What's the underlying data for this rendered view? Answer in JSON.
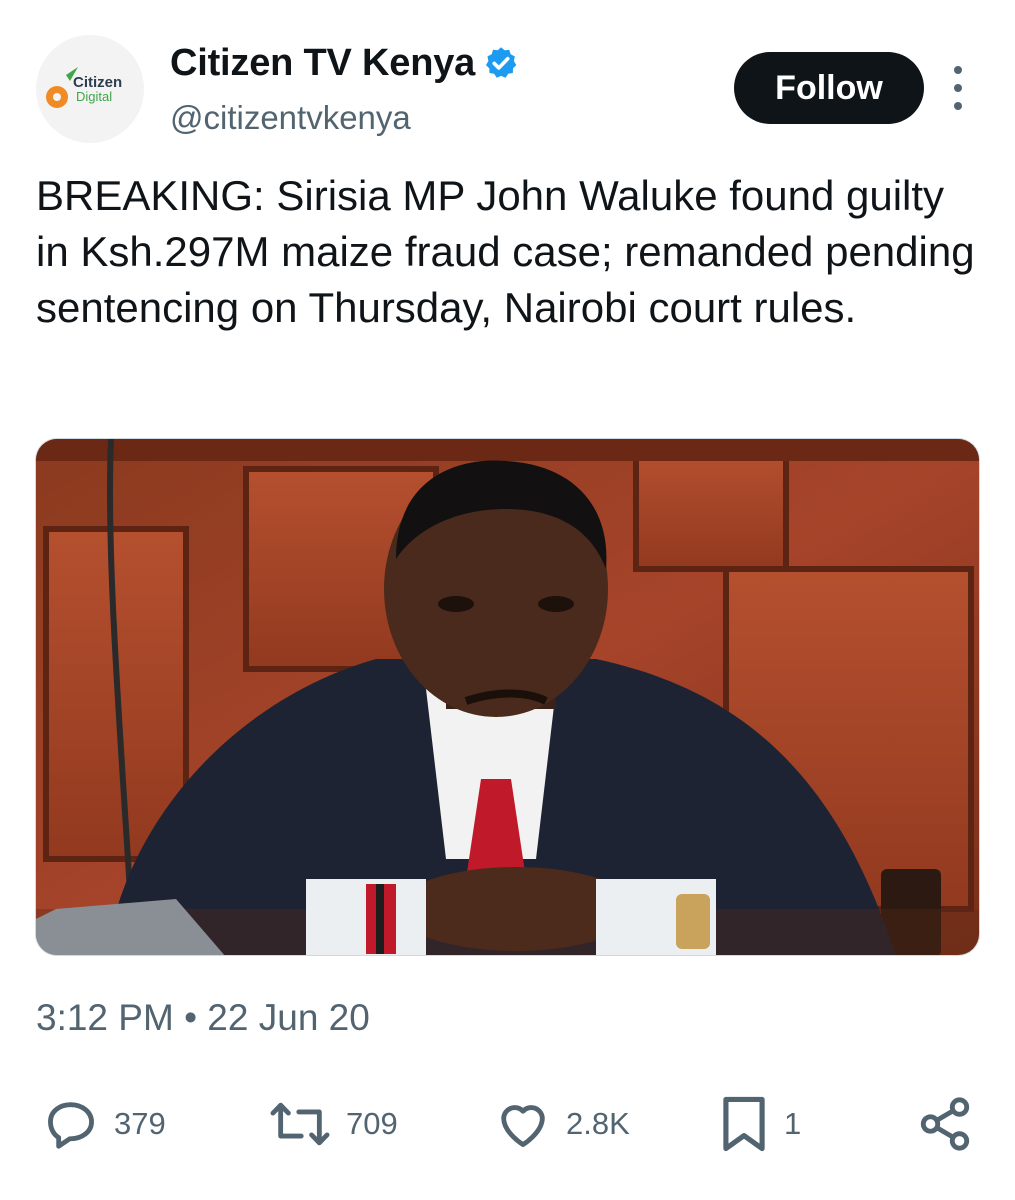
{
  "author": {
    "display_name": "Citizen TV Kenya",
    "handle": "@citizentvkenya",
    "avatar": {
      "logo_text_line1": "Citizen",
      "logo_text_line2": "Digital"
    }
  },
  "follow_button": {
    "label": "Follow"
  },
  "tweet": {
    "text": "BREAKING: Sirisia MP John Waluke found guilty in Ksh.297M maize fraud case; remanded pending sentencing on Thursday, Nairobi court rules.",
    "timestamp": "3:12 PM • 22 Jun 20"
  },
  "actions": {
    "replies": "379",
    "retweets": "709",
    "likes": "2.8K",
    "bookmarks": "1"
  },
  "icons": {
    "verified": "verified-badge-icon",
    "more": "more-options-icon",
    "reply": "reply-icon",
    "retweet": "retweet-icon",
    "like": "heart-icon",
    "bookmark": "bookmark-icon",
    "share": "share-icon"
  },
  "colors": {
    "verified_blue": "#1d9bf0",
    "text_primary": "#0f1419",
    "text_secondary": "#536471",
    "button_bg": "#0f1419"
  }
}
